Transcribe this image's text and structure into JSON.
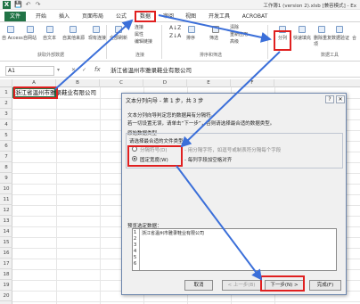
{
  "window": {
    "title": "工作簿1 (version 2).xlsb [兼容模式] - Ex"
  },
  "qat": {
    "app_icon": "X",
    "save": "💾",
    "undo": "↶",
    "redo": "↷"
  },
  "tabs": [
    "文件",
    "开始",
    "插入",
    "页面布局",
    "公式",
    "数据",
    "审阅",
    "视图",
    "开发工具",
    "ACROBAT"
  ],
  "ribbon": {
    "ext_items": [
      "自 Access",
      "自网站",
      "自文本",
      "自其他来源",
      "现有连接"
    ],
    "refresh": "全部刷新",
    "conn_items": [
      "连接",
      "属性",
      "编辑链接"
    ],
    "sort_items": [
      "排序"
    ],
    "filter": "筛选",
    "adv_items": [
      "清除",
      "重新应用",
      "高级"
    ],
    "tools": [
      "分列",
      "快速填充",
      "删除重复项",
      "数据验证"
    ],
    "tools_extra": "合",
    "groups": [
      "获取外部数据",
      "连接",
      "排序和筛选",
      "数据工具"
    ]
  },
  "formula_bar": {
    "name_box": "A1",
    "fx": "fx",
    "content": "浙江省温州市雅录鞋业有限公司"
  },
  "columns": [
    "A",
    "B",
    "C",
    "D",
    "E",
    "F"
  ],
  "rows": [
    "1",
    "2",
    "3",
    "4",
    "5",
    "6",
    "7",
    "8",
    "9",
    "10",
    "11",
    "12",
    "13",
    "14",
    "15",
    "16",
    "17",
    "18",
    "19",
    "20"
  ],
  "cell_a1": "浙江省温州市雅录鞋业有限公司",
  "dialog": {
    "title": "文本分列向导 - 第 1 步，共 3 步",
    "help": "?",
    "close": "✕",
    "line1": "文本分列向导判定您的数据具有分隔符。",
    "line2": "若一切设置无误，请单击“下一步”，否则请选择最合适的数据类型。",
    "section": "原始数据类型",
    "choose_label": "请选择最合适的文件类型：",
    "opt1": "分隔符号(D)",
    "opt1_desc": "- 用分隔字符，如逗号或制表符分隔每个字段",
    "opt2": "固定宽度(W)",
    "opt2_desc": "- 每列字段加空格对齐",
    "preview_label": "预览选定数据：",
    "preview_rows": [
      "1",
      "2",
      "3",
      "4",
      "5",
      "6"
    ],
    "preview_content": "浙江省温州市雅录鞋业有限公司",
    "btn_cancel": "取消",
    "btn_back": "< 上一步(B)",
    "btn_next": "下一步(N) >",
    "btn_finish": "完成(F)"
  },
  "colors": {
    "excel_green": "#217346",
    "annotation_red": "#e02020",
    "arrow_blue": "#3b6fd9"
  }
}
